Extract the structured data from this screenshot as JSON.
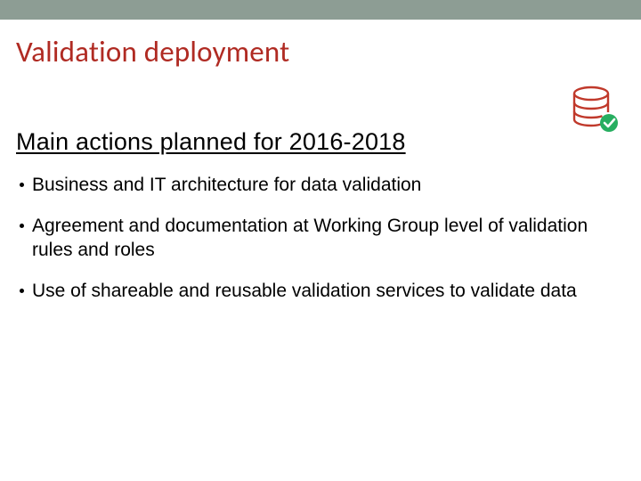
{
  "slide": {
    "title": "Validation deployment",
    "section_title": "Main actions planned for 2016-2018",
    "bullets": [
      "Business and IT architecture for data validation",
      "Agreement and documentation at Working Group level of validation rules and roles",
      "Use of shareable and reusable validation services to validate data"
    ],
    "icon": "database-check-icon"
  }
}
